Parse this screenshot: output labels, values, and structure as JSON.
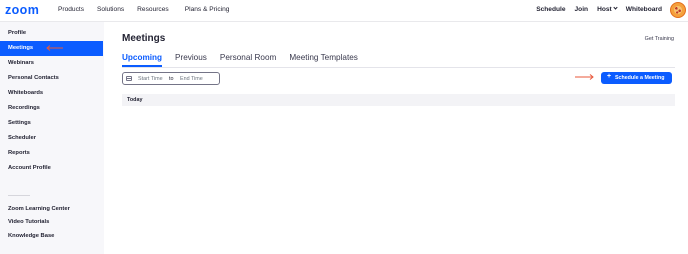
{
  "header": {
    "logo": "zoom",
    "nav_left": [
      "Products",
      "Solutions",
      "Resources",
      "Plans & Pricing"
    ],
    "nav_right": {
      "schedule": "Schedule",
      "join": "Join",
      "host": "Host",
      "whiteboard": "Whiteboard"
    }
  },
  "sidebar": {
    "items": [
      {
        "label": "Profile"
      },
      {
        "label": "Meetings",
        "active": true
      },
      {
        "label": "Webinars"
      },
      {
        "label": "Personal Contacts"
      },
      {
        "label": "Whiteboards"
      },
      {
        "label": "Recordings"
      },
      {
        "label": "Settings"
      },
      {
        "label": "Scheduler"
      },
      {
        "label": "Reports"
      },
      {
        "label": "Account Profile"
      }
    ],
    "links": [
      {
        "label": "Zoom Learning Center"
      },
      {
        "label": "Video Tutorials"
      },
      {
        "label": "Knowledge Base"
      }
    ]
  },
  "main": {
    "title": "Meetings",
    "get_training": "Get Training",
    "tabs": [
      {
        "label": "Upcoming",
        "active": true
      },
      {
        "label": "Previous"
      },
      {
        "label": "Personal Room"
      },
      {
        "label": "Meeting Templates"
      }
    ],
    "date_range": {
      "start_placeholder": "Start Time",
      "to": "to",
      "end_placeholder": "End Time"
    },
    "schedule_button": {
      "plus": "+",
      "label": "Schedule a Meeting"
    },
    "today_label": "Today"
  },
  "colors": {
    "accent": "#0b5cff",
    "annotation_arrow": "#e8573a"
  }
}
